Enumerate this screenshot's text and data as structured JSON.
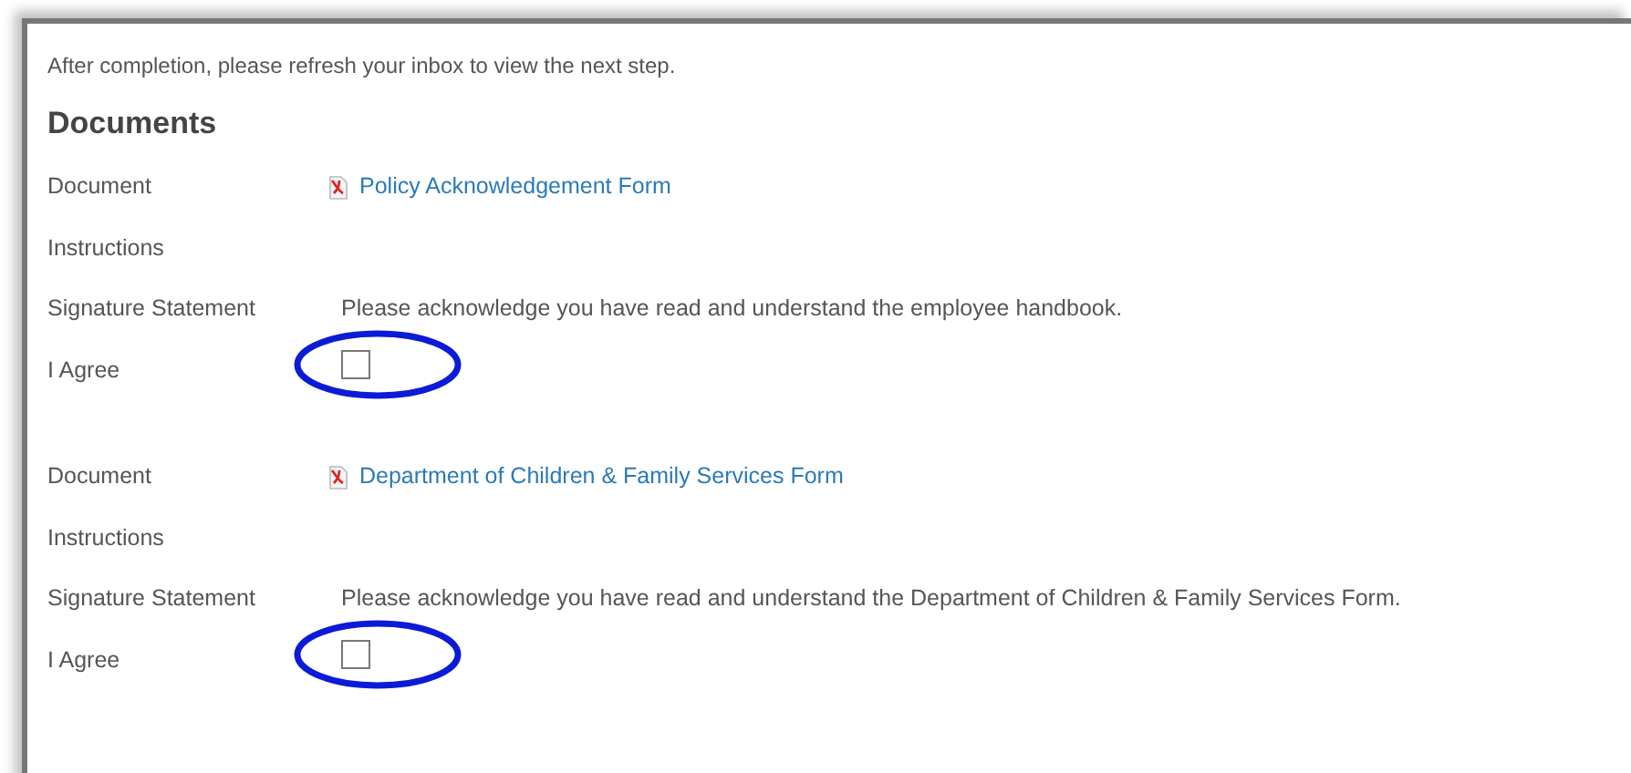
{
  "intro": "After completion, please refresh your inbox to view the next step.",
  "heading": "Documents",
  "documents": [
    {
      "document_label": "Document",
      "document_link": "Policy Acknowledgement Form",
      "instructions_label": "Instructions",
      "signature_label": "Signature Statement",
      "signature_statement": "Please acknowledge you have read and understand the employee handbook.",
      "agree_label": "I Agree",
      "checked": false,
      "highlighted": true
    },
    {
      "document_label": "Document",
      "document_link": "Department of Children & Family Services Form",
      "instructions_label": "Instructions",
      "signature_label": "Signature Statement",
      "signature_statement": "Please acknowledge you have read and understand the Department of Children & Family Services Form.",
      "agree_label": "I Agree",
      "checked": false,
      "highlighted": true
    }
  ]
}
